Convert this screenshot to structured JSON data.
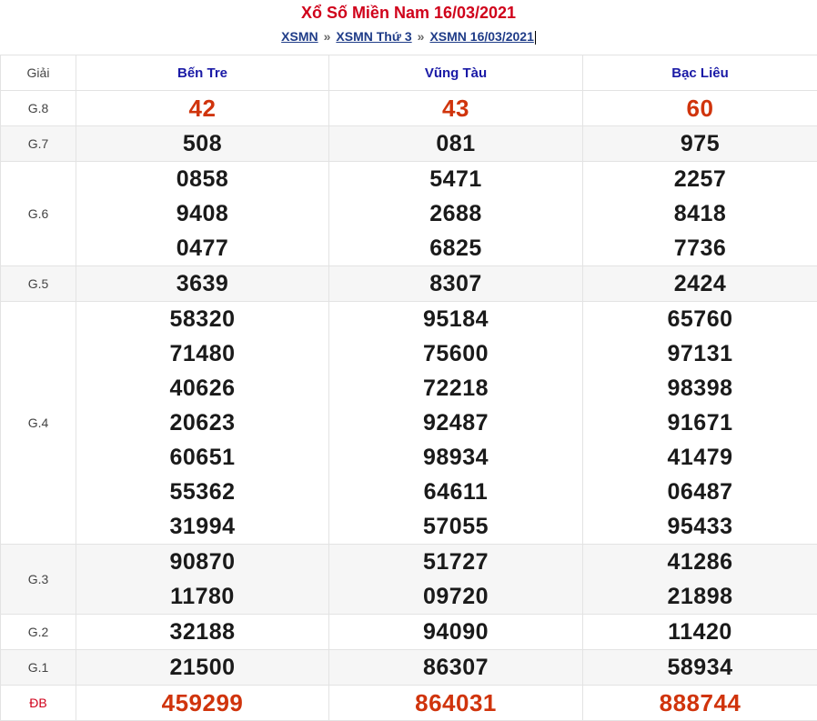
{
  "header": {
    "title": "Xổ Số Miền Nam 16/03/2021",
    "crumbs": [
      "XSMN",
      "XSMN Thứ 3",
      "XSMN 16/03/2021"
    ],
    "separator": "»"
  },
  "table": {
    "label_header": "Giải",
    "provinces": [
      "Bến Tre",
      "Vũng Tàu",
      "Bạc Liêu"
    ],
    "rows": [
      {
        "label": "G.8",
        "values": [
          [
            "42"
          ],
          [
            "43"
          ],
          [
            "60"
          ]
        ],
        "red": true,
        "alt": false
      },
      {
        "label": "G.7",
        "values": [
          [
            "508"
          ],
          [
            "081"
          ],
          [
            "975"
          ]
        ],
        "red": false,
        "alt": true
      },
      {
        "label": "G.6",
        "values": [
          [
            "0858",
            "9408",
            "0477"
          ],
          [
            "5471",
            "2688",
            "6825"
          ],
          [
            "2257",
            "8418",
            "7736"
          ]
        ],
        "red": false,
        "alt": false
      },
      {
        "label": "G.5",
        "values": [
          [
            "3639"
          ],
          [
            "8307"
          ],
          [
            "2424"
          ]
        ],
        "red": false,
        "alt": true
      },
      {
        "label": "G.4",
        "values": [
          [
            "58320",
            "71480",
            "40626",
            "20623",
            "60651",
            "55362",
            "31994"
          ],
          [
            "95184",
            "75600",
            "72218",
            "92487",
            "98934",
            "64611",
            "57055"
          ],
          [
            "65760",
            "97131",
            "98398",
            "91671",
            "41479",
            "06487",
            "95433"
          ]
        ],
        "red": false,
        "alt": false
      },
      {
        "label": "G.3",
        "values": [
          [
            "90870",
            "11780"
          ],
          [
            "51727",
            "09720"
          ],
          [
            "41286",
            "21898"
          ]
        ],
        "red": false,
        "alt": true
      },
      {
        "label": "G.2",
        "values": [
          [
            "32188"
          ],
          [
            "94090"
          ],
          [
            "11420"
          ]
        ],
        "red": false,
        "alt": false
      },
      {
        "label": "G.1",
        "values": [
          [
            "21500"
          ],
          [
            "86307"
          ],
          [
            "58934"
          ]
        ],
        "red": false,
        "alt": true
      },
      {
        "label": "ĐB",
        "values": [
          [
            "459299"
          ],
          [
            "864031"
          ],
          [
            "888744"
          ]
        ],
        "red": true,
        "alt": false
      }
    ]
  }
}
